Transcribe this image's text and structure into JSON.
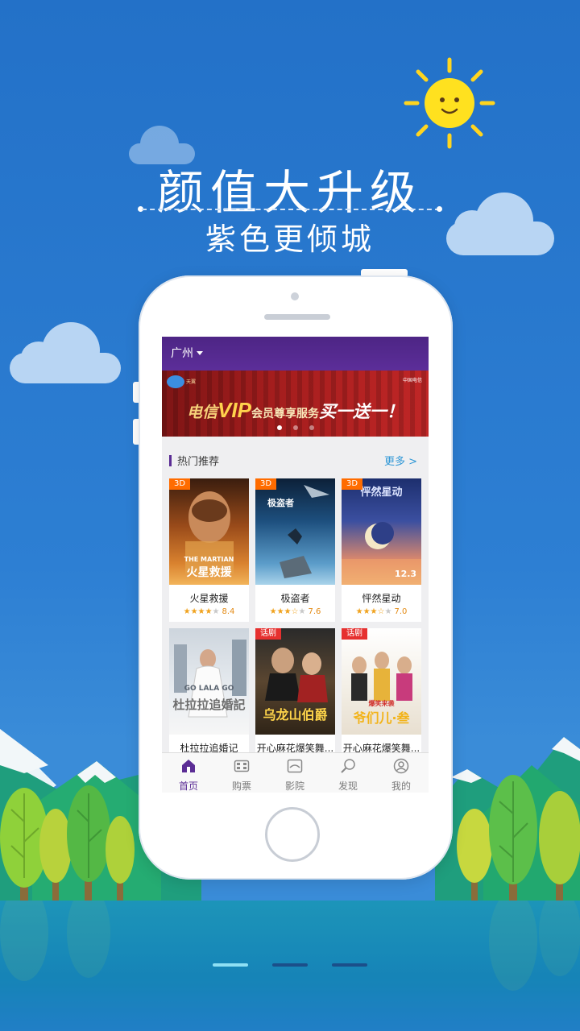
{
  "headline": {
    "title": "颜值大升级",
    "subtitle": "紫色更倾城"
  },
  "app": {
    "city": "广州",
    "banner": {
      "brand_left": "天翼",
      "brand_right": "中国电信",
      "text_prefix": "电信",
      "text_vip": "VIP",
      "text_service": "会员尊享服务",
      "text_offer": "买一送一！",
      "slide_count": 3,
      "active_slide": 1
    },
    "section": {
      "title": "热门推荐",
      "more_label": "更多 >"
    },
    "movies": [
      {
        "name": "火星救援",
        "tag": "3D",
        "rating": "8.4",
        "stars": 4,
        "poster_title": "火星救援",
        "poster_sub": "THE MARTIAN"
      },
      {
        "name": "极盗者",
        "tag": "3D",
        "rating": "7.6",
        "stars": 3.5,
        "poster_title": "极盗者",
        "poster_sub": ""
      },
      {
        "name": "怦然星动",
        "tag": "3D",
        "rating": "7.0",
        "stars": 3.5,
        "poster_title": "怦然星动",
        "poster_sub": "12.3"
      },
      {
        "name": "杜拉拉追婚记",
        "tag": "",
        "rating": "",
        "stars": 0,
        "poster_title": "杜拉拉追婚記",
        "poster_sub": "GO LALA GO"
      },
      {
        "name": "开心麻花爆笑舞...",
        "tag": "话剧",
        "rating": "",
        "stars": 0,
        "poster_title": "乌龙山伯爵",
        "poster_sub": ""
      },
      {
        "name": "开心麻花爆笑舞...",
        "tag": "话剧",
        "rating": "",
        "stars": 0,
        "poster_title": "爷们儿·叁",
        "poster_sub": "爆笑来袭"
      }
    ],
    "tabs": [
      {
        "label": "首页",
        "icon": "home-icon",
        "active": true
      },
      {
        "label": "购票",
        "icon": "ticket-icon",
        "active": false
      },
      {
        "label": "影院",
        "icon": "cinema-icon",
        "active": false
      },
      {
        "label": "发现",
        "icon": "discover-icon",
        "active": false
      },
      {
        "label": "我的",
        "icon": "profile-icon",
        "active": false
      }
    ]
  },
  "pager": {
    "count": 3,
    "active": 1
  },
  "colors": {
    "sky": "#2a79cd",
    "accent_purple": "#5b2d95",
    "tag_orange": "#ff6c00",
    "tag_red": "#e6302f",
    "link_blue": "#2f97d6"
  }
}
